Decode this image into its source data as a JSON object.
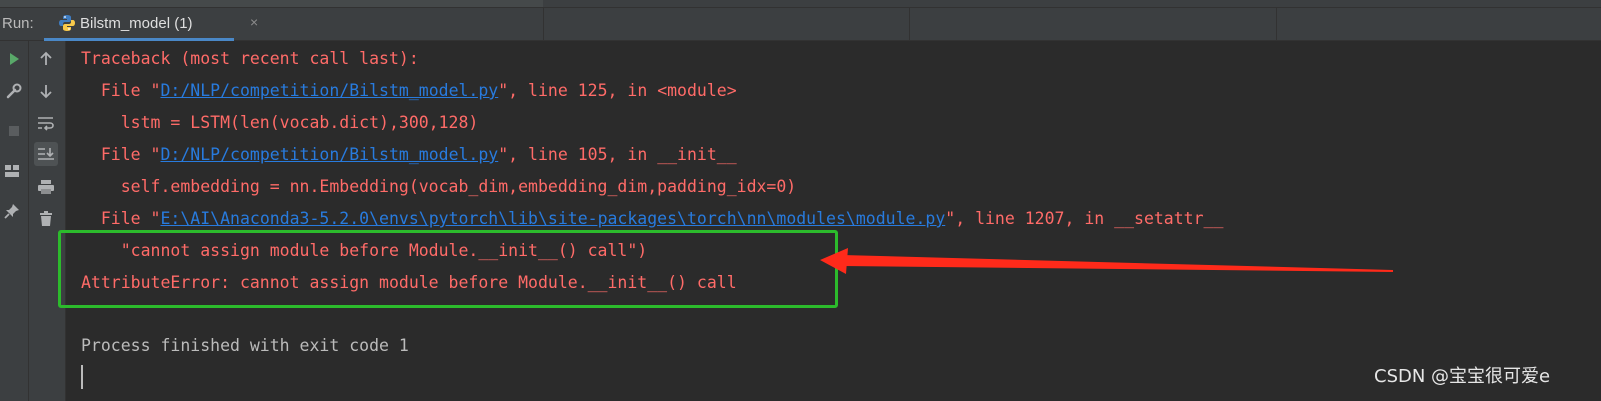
{
  "run_panel": {
    "label": "Run:",
    "tab": {
      "title": "Bilstm_model (1)",
      "icon": "python-icon",
      "close_glyph": "×"
    }
  },
  "toolbar_left": {
    "buttons": [
      {
        "name": "rerun-icon",
        "color": "#59a869"
      },
      {
        "name": "wrench-icon"
      },
      {
        "name": "stop-icon"
      },
      {
        "name": "layout-icon"
      },
      {
        "name": "pin-icon"
      }
    ]
  },
  "toolbar_right": {
    "buttons": [
      {
        "name": "up-arrow-icon"
      },
      {
        "name": "down-arrow-icon"
      },
      {
        "name": "soft-wrap-icon"
      },
      {
        "name": "scroll-to-end-icon",
        "selected": true
      },
      {
        "name": "print-icon"
      },
      {
        "name": "trash-icon"
      }
    ]
  },
  "console": {
    "traceback_header": "Traceback (most recent call last):",
    "frames": [
      {
        "prefix": "  File \"",
        "path": "D:/NLP/competition/Bilstm_model.py",
        "suffix": "\", line 125, in <module>",
        "code": "    lstm = LSTM(len(vocab.dict),300,128)"
      },
      {
        "prefix": "  File \"",
        "path": "D:/NLP/competition/Bilstm_model.py",
        "suffix": "\", line 105, in __init__",
        "code": "    self.embedding = nn.Embedding(vocab_dim,embedding_dim,padding_idx=0)"
      },
      {
        "prefix": "  File \"",
        "path": "E:\\AI\\Anaconda3-5.2.0\\envs\\pytorch\\lib\\site-packages\\torch\\nn\\modules\\module.py",
        "suffix": "\", line 1207, in __setattr__",
        "code": "    \"cannot assign module before Module.__init__() call\")"
      }
    ],
    "error": "AttributeError: cannot assign module before Module.__init__() call",
    "exit_message": "Process finished with exit code 1"
  },
  "colors": {
    "error_text": "#ff6b68",
    "link": "#287bde",
    "highlight_box": "#2cbb2c",
    "arrow": "#ff2a1a"
  },
  "watermark": "CSDN @宝宝很可爱e"
}
